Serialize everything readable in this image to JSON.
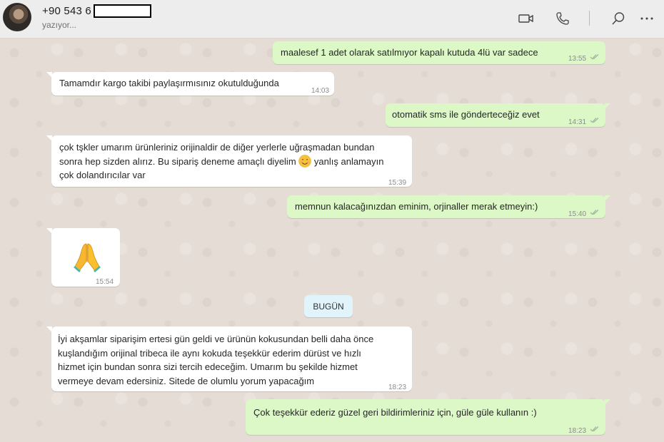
{
  "header": {
    "contact": "+90 543 6",
    "status": "yazıyor...",
    "icons": [
      "video-call-icon",
      "voice-call-icon",
      "search-icon",
      "more-options-icon"
    ]
  },
  "date_badge": "BUGÜN",
  "colors": {
    "incoming": "#ffffff",
    "outgoing": "#dcf8c6",
    "background": "#e5ddd5",
    "badge": "#e1f3fb",
    "read_ticks": "#4fc3f7"
  },
  "messages": [
    {
      "dir": "out",
      "text": "maalesef 1 adet olarak satılmıyor kapalı kutuda 4lü var sadece",
      "time": "13:55"
    },
    {
      "dir": "in",
      "text": "Tamamdır kargo takibi paylaşırmısınız okutulduğunda",
      "time": "14:03"
    },
    {
      "dir": "out",
      "text": "otomatik sms ile gönderteceğiz evet",
      "time": "14:31"
    },
    {
      "dir": "in",
      "lines": [
        "çok tşkler umarım ürünleriniz orijinaldir de diğer yerlerle uğraşmadan bundan",
        "sonra hep sizden alırız. Bu sipariş deneme amaçlı diyelim",
        "yanlış anlamayın",
        "çok dolandırıcılar var"
      ],
      "time": "15:39"
    },
    {
      "dir": "out",
      "text": "memnun kalacağınızdan eminim, orjinaller merak etmeyin:)",
      "time": "15:40"
    },
    {
      "dir": "in",
      "emoji": "folded-hands-emoji",
      "time": "15:54"
    },
    {
      "dir": "in",
      "lines": [
        "İyi akşamlar siparişim ertesi gün geldi ve ürünün kokusundan belli daha önce",
        "kuşlandığım orijinal tribeca ile aynı kokuda teşekkür ederim dürüst ve hızlı",
        "hizmet için bundan sonra sizi tercih edeceğim. Umarım bu şekilde hizmet",
        "vermeye devam edersiniz. Sitede de olumlu yorum yapacağım"
      ],
      "time": "18:23"
    },
    {
      "dir": "out",
      "text": "Çok teşekkür ederiz güzel geri bildirimleriniz için, güle güle kullanın :)",
      "time": "18:23"
    }
  ]
}
